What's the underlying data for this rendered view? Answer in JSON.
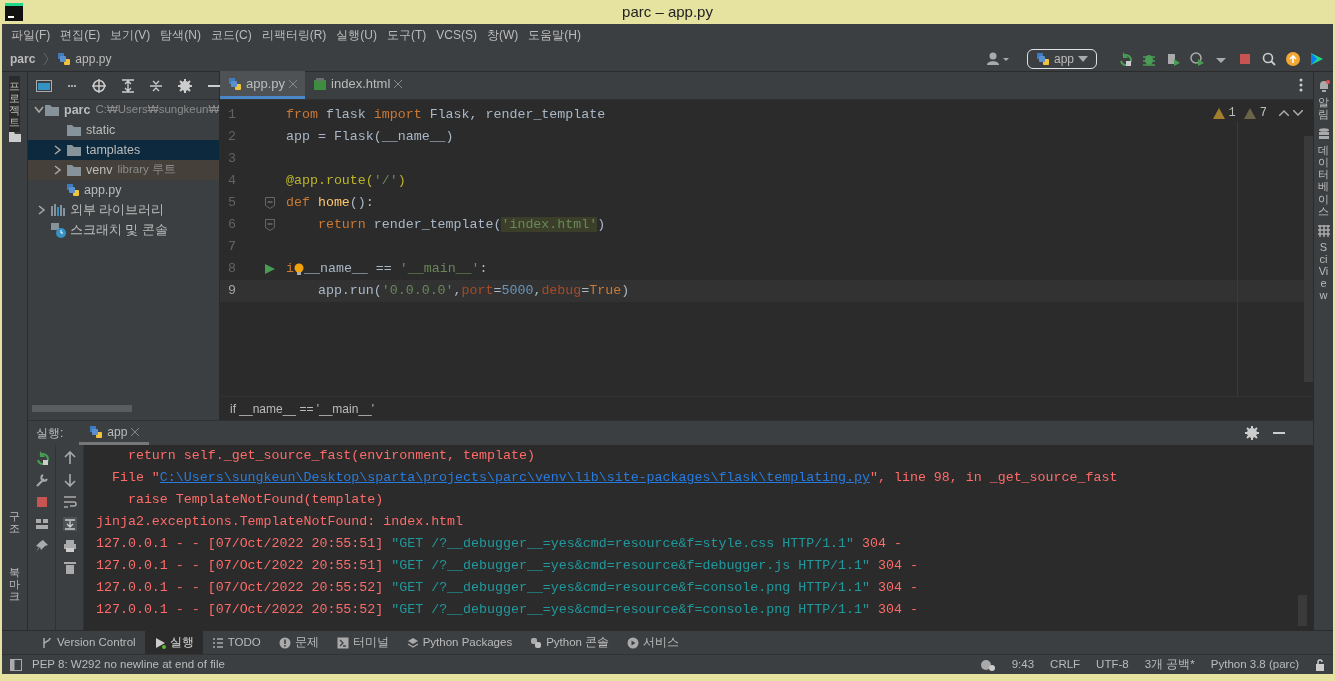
{
  "window": {
    "title": "parc – app.py"
  },
  "menu": [
    "파일(F)",
    "편집(E)",
    "보기(V)",
    "탐색(N)",
    "코드(C)",
    "리팩터링(R)",
    "실행(U)",
    "도구(T)",
    "VCS(S)",
    "창(W)",
    "도움말(H)"
  ],
  "breadcrumb": {
    "project": "parc",
    "file": "app.py"
  },
  "toolbar": {
    "run_config": "app"
  },
  "left_stripe": {
    "top": [
      {
        "label": "프로젝트",
        "selected": true
      }
    ],
    "bottom": [
      {
        "label": "구조",
        "selected": false
      },
      {
        "label": "북마크",
        "selected": false
      }
    ]
  },
  "right_stripe": [
    "알림",
    "데이터베이스",
    "SciView"
  ],
  "project_panel": {
    "tree": [
      {
        "label": "parc",
        "hint": "C:₩Users₩sungkeun₩",
        "kind": "folder",
        "expanded": true,
        "selected": false,
        "children": [
          {
            "label": "static",
            "kind": "folder",
            "selected": false
          },
          {
            "label": "tamplates",
            "kind": "folder",
            "expanded": false,
            "selected": true
          },
          {
            "label": "venv",
            "hint": "library 루트",
            "kind": "library",
            "expanded": false,
            "selected": false
          },
          {
            "label": "app.py",
            "kind": "python",
            "selected": false
          }
        ]
      },
      {
        "label": "외부 라이브러리",
        "kind": "libraries",
        "expanded": false,
        "selected": false
      },
      {
        "label": "스크래치 및 콘솔",
        "kind": "scratches",
        "selected": false
      }
    ]
  },
  "editor": {
    "tabs": [
      {
        "label": "app.py",
        "kind": "python",
        "selected": true
      },
      {
        "label": "index.html",
        "kind": "html",
        "selected": false
      }
    ],
    "inspections": {
      "warnings": "1",
      "weak_warnings": "7"
    },
    "lines": [
      {
        "number": "1",
        "current": false,
        "tokens": [
          {
            "text": "from",
            "kind": "kw"
          },
          {
            "text": " flask ",
            "kind": "plain"
          },
          {
            "text": "import",
            "kind": "kw"
          },
          {
            "text": " Flask, render_template",
            "kind": "plain"
          }
        ]
      },
      {
        "number": "2",
        "current": false,
        "tokens": [
          {
            "text": "app = Flask(__name__)",
            "kind": "plain"
          }
        ]
      },
      {
        "number": "3",
        "current": false
      },
      {
        "number": "4",
        "current": false,
        "tokens": [
          {
            "text": "@app.route(",
            "kind": "dec"
          },
          {
            "text": "'/'",
            "kind": "str"
          },
          {
            "text": ")",
            "kind": "dec"
          }
        ]
      },
      {
        "number": "5",
        "current": false,
        "fold": true,
        "tokens": [
          {
            "text": "def ",
            "kind": "kw"
          },
          {
            "text": "home",
            "kind": "fn"
          },
          {
            "text": "():",
            "kind": "plain"
          }
        ]
      },
      {
        "number": "6",
        "current": false,
        "fold": true,
        "tokens": [
          {
            "text": "    return",
            "kind": "kw"
          },
          {
            "text": " render_template(",
            "kind": "plain"
          },
          {
            "text": "'index.html'",
            "kind": "strhl"
          },
          {
            "text": ")",
            "kind": "plain"
          }
        ]
      },
      {
        "number": "7",
        "current": false
      },
      {
        "number": "8",
        "current": false,
        "run": true,
        "tokens": [
          {
            "text": "i",
            "kind": "kw"
          },
          {
            "kind": "bulb"
          },
          {
            "text": "__name__ == ",
            "kind": "plain"
          },
          {
            "text": "'__main__'",
            "kind": "str"
          },
          {
            "text": ":",
            "kind": "plain"
          }
        ]
      },
      {
        "number": "9",
        "current": true,
        "tokens": [
          {
            "text": "    app.run(",
            "kind": "plain"
          },
          {
            "text": "'0.0.0.0'",
            "kind": "str"
          },
          {
            "text": ",",
            "kind": "plain"
          },
          {
            "text": "port",
            "kind": "param"
          },
          {
            "text": "=",
            "kind": "plain"
          },
          {
            "text": "5000",
            "kind": "num"
          },
          {
            "text": ",",
            "kind": "plain"
          },
          {
            "text": "debug",
            "kind": "param"
          },
          {
            "text": "=",
            "kind": "plain"
          },
          {
            "text": "True",
            "kind": "kw"
          },
          {
            "text": ")",
            "kind": "plain"
          }
        ]
      }
    ],
    "footer": "if __name__ == '__main__'"
  },
  "run_panel": {
    "label": "실행:",
    "tab": "app",
    "console": [
      [
        {
          "text": "    return self._get_source_fast(environment, template)",
          "kind": "err"
        }
      ],
      [
        {
          "text": "  File \"",
          "kind": "err"
        },
        {
          "text": "C:\\Users\\sungkeun\\Desktop\\sparta\\projects\\parc\\venv\\lib\\site-packages\\flask\\templating.py",
          "kind": "link"
        },
        {
          "text": "\", line 98, in _get_source_fast",
          "kind": "err"
        }
      ],
      [
        {
          "text": "    raise TemplateNotFound(template)",
          "kind": "err"
        }
      ],
      [
        {
          "text": "jinja2.exceptions.TemplateNotFound: index.html",
          "kind": "err"
        }
      ],
      [
        {
          "text": "127.0.0.1 - - [07/Oct/2022 20:55:51] ",
          "kind": "err"
        },
        {
          "text": "\"GET /?__debugger__=yes&cmd=resource&f=style.css HTTP/1.1\"",
          "kind": "get"
        },
        {
          "text": " 304 -",
          "kind": "err"
        }
      ],
      [
        {
          "text": "127.0.0.1 - - [07/Oct/2022 20:55:51] ",
          "kind": "err"
        },
        {
          "text": "\"GET /?__debugger__=yes&cmd=resource&f=debugger.js HTTP/1.1\"",
          "kind": "get"
        },
        {
          "text": " 304 -",
          "kind": "err"
        }
      ],
      [
        {
          "text": "127.0.0.1 - - [07/Oct/2022 20:55:52] ",
          "kind": "err"
        },
        {
          "text": "\"GET /?__debugger__=yes&cmd=resource&f=console.png HTTP/1.1\"",
          "kind": "get"
        },
        {
          "text": " 304 -",
          "kind": "err"
        }
      ],
      [
        {
          "text": "127.0.0.1 - - [07/Oct/2022 20:55:52] ",
          "kind": "err"
        },
        {
          "text": "\"GET /?__debugger__=yes&cmd=resource&f=console.png HTTP/1.1\"",
          "kind": "get"
        },
        {
          "text": " 304 -",
          "kind": "err"
        }
      ]
    ]
  },
  "tool_windows": [
    {
      "label": "Version Control",
      "kind": "vcs",
      "selected": false
    },
    {
      "label": "실행",
      "kind": "run",
      "selected": true
    },
    {
      "label": "TODO",
      "kind": "todo",
      "selected": false
    },
    {
      "label": "문제",
      "kind": "problems",
      "selected": false
    },
    {
      "label": "터미널",
      "kind": "terminal",
      "selected": false
    },
    {
      "label": "Python Packages",
      "kind": "packages",
      "selected": false
    },
    {
      "label": "Python 콘솔",
      "kind": "console",
      "selected": false
    },
    {
      "label": "서비스",
      "kind": "services",
      "selected": false
    }
  ],
  "status_bar": {
    "message": "PEP 8: W292 no newline at end of file",
    "items": [
      "9:43",
      "CRLF",
      "UTF-8",
      "3개 공백*",
      "Python 3.8 (parc)"
    ]
  }
}
